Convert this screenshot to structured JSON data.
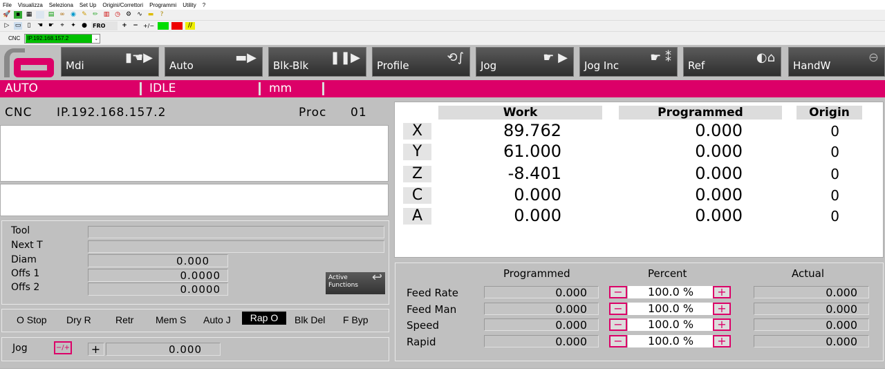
{
  "menu": [
    "File",
    "Visualizza",
    "Seleziona",
    "Set Up",
    "Origini/Correttori",
    "Programmi",
    "Utility",
    "?"
  ],
  "toolbar": {
    "fro_label": "FRO",
    "plus": "+",
    "minus": "−",
    "plusminus": "+/−"
  },
  "cnc_row": {
    "label": "CNC",
    "ip_value": "IP.192.168.157.2"
  },
  "modes": [
    {
      "label": "Mdi"
    },
    {
      "label": "Auto"
    },
    {
      "label": "Blk-Blk"
    },
    {
      "label": "Profile"
    },
    {
      "label": "Jog"
    },
    {
      "label": "Jog Inc"
    },
    {
      "label": "Ref"
    },
    {
      "label": "HandW"
    }
  ],
  "status": {
    "mode": "AUTO",
    "state": "IDLE",
    "units": "mm"
  },
  "left": {
    "cnc_label": "CNC",
    "ip": "IP.192.168.157.2",
    "proc_label": "Proc",
    "proc_value": "01"
  },
  "tool": {
    "tool_label": "Tool",
    "tool_value": "",
    "next_label": "Next T",
    "next_value": "",
    "diam_label": "Diam",
    "diam_value": "0.000",
    "offs1_label": "Offs 1",
    "offs1_value": "0.0000",
    "offs2_label": "Offs 2",
    "offs2_value": "0.0000",
    "active_functions": "Active Functions"
  },
  "functions": [
    "O Stop",
    "Dry R",
    "Retr",
    "Mem S",
    "Auto J",
    "Rap O",
    "Blk Del",
    "F Byp"
  ],
  "jog": {
    "label": "Jog",
    "sign": "−/+",
    "plus": "+",
    "value": "0.000"
  },
  "coords": {
    "headers": {
      "work": "Work",
      "programmed": "Programmed",
      "origin": "Origin"
    },
    "rows": [
      {
        "axis": "X",
        "work": "89.762",
        "programmed": "0.000",
        "origin": "0"
      },
      {
        "axis": "Y",
        "work": "61.000",
        "programmed": "0.000",
        "origin": "0"
      },
      {
        "axis": "Z",
        "work": "-8.401",
        "programmed": "0.000",
        "origin": "0"
      },
      {
        "axis": "C",
        "work": "0.000",
        "programmed": "0.000",
        "origin": "0"
      },
      {
        "axis": "A",
        "work": "0.000",
        "programmed": "0.000",
        "origin": "0"
      }
    ]
  },
  "feeds": {
    "headers": {
      "programmed": "Programmed",
      "percent": "Percent",
      "actual": "Actual"
    },
    "rows": [
      {
        "label": "Feed Rate",
        "programmed": "0.000",
        "percent": "100.0 %",
        "actual": "0.000"
      },
      {
        "label": "Feed Man",
        "programmed": "0.000",
        "percent": "100.0 %",
        "actual": "0.000"
      },
      {
        "label": "Speed",
        "programmed": "0.000",
        "percent": "100.0 %",
        "actual": "0.000"
      },
      {
        "label": "Rapid",
        "programmed": "0.000",
        "percent": "100.0 %",
        "actual": "0.000"
      }
    ],
    "minus": "−",
    "plus": "+"
  },
  "colors": {
    "accent": "#dc0068",
    "ip_bg": "#00c000"
  }
}
